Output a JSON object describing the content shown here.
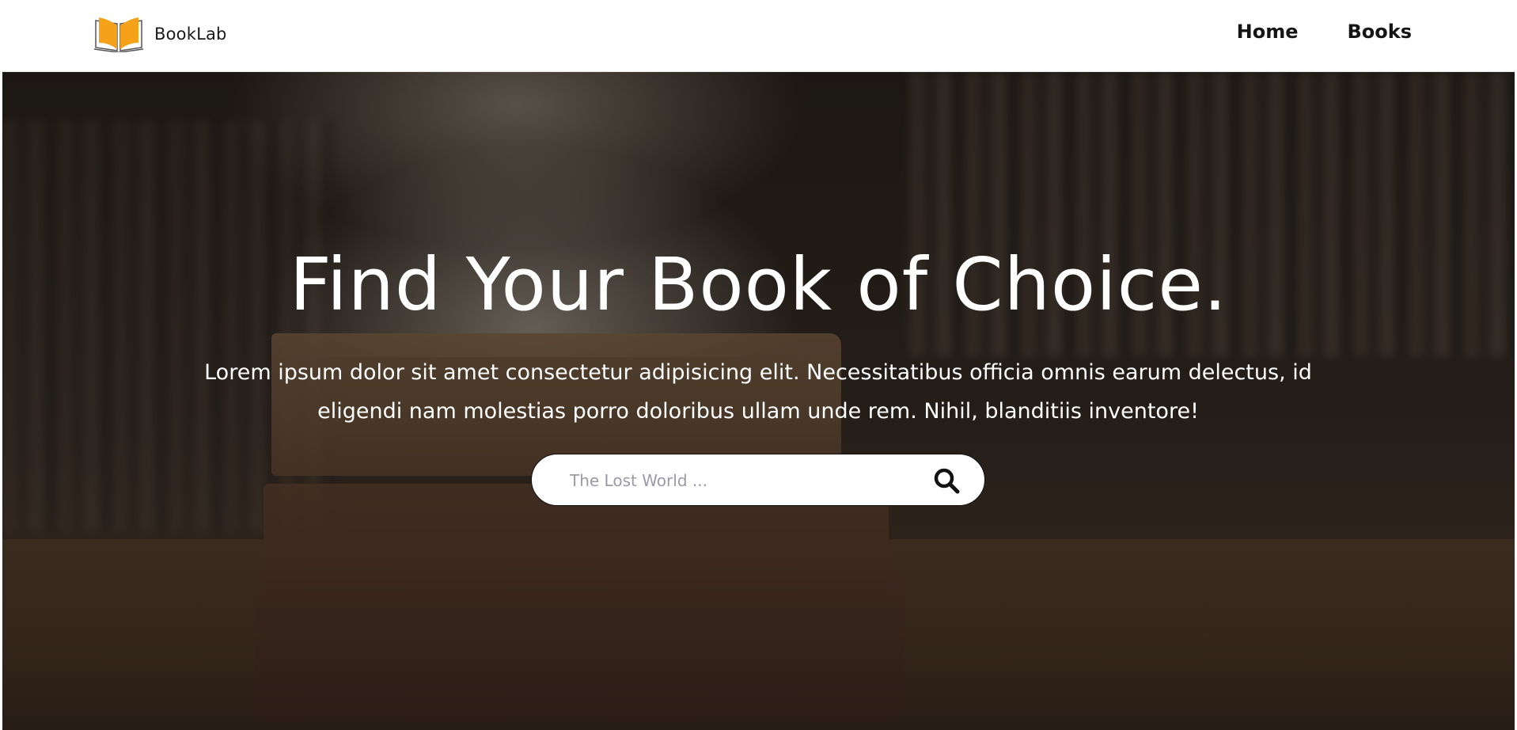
{
  "navbar": {
    "brand_name": "BookLab",
    "logo_icon": "open-book-icon",
    "accent_color": "#f5a21a",
    "links": [
      {
        "label": "Home"
      },
      {
        "label": "Books"
      }
    ]
  },
  "hero": {
    "title": "Find Your Book of Choice.",
    "text": "Lorem ipsum dolor sit amet consectetur adipisicing elit. Necessitatibus officia omnis earum delectus, id eligendi nam molestias porro doloribus ullam unde rem. Nihil, blanditiis inventore!",
    "search": {
      "placeholder": "The Lost World ...",
      "value": "",
      "button_icon": "search-icon"
    }
  }
}
